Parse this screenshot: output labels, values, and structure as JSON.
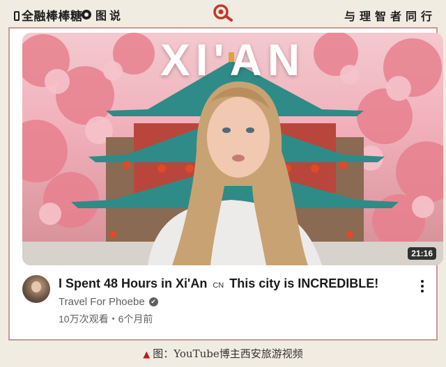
{
  "header": {
    "brand": "全融棒棒糖",
    "section": "图说",
    "slogan": "与理智者同行"
  },
  "video": {
    "thumbnail_title": "XI'AN",
    "duration": "21:16",
    "title_part1": "I Spent 48 Hours in Xi'An",
    "flag": "CN",
    "title_part2": "This city is INCREDIBLE!",
    "channel": "Travel For Phoebe",
    "verified_mark": "✔",
    "meta": "10万次观看・6个月前"
  },
  "caption": {
    "marker": "▲",
    "text": "图：YouTube博主西安旅游视频"
  },
  "colors": {
    "accent": "#c0392b",
    "frame_border": "#c99a96",
    "background": "#f1ece2"
  },
  "icons": [
    "search-icon",
    "verified-icon",
    "more-options-icon"
  ]
}
